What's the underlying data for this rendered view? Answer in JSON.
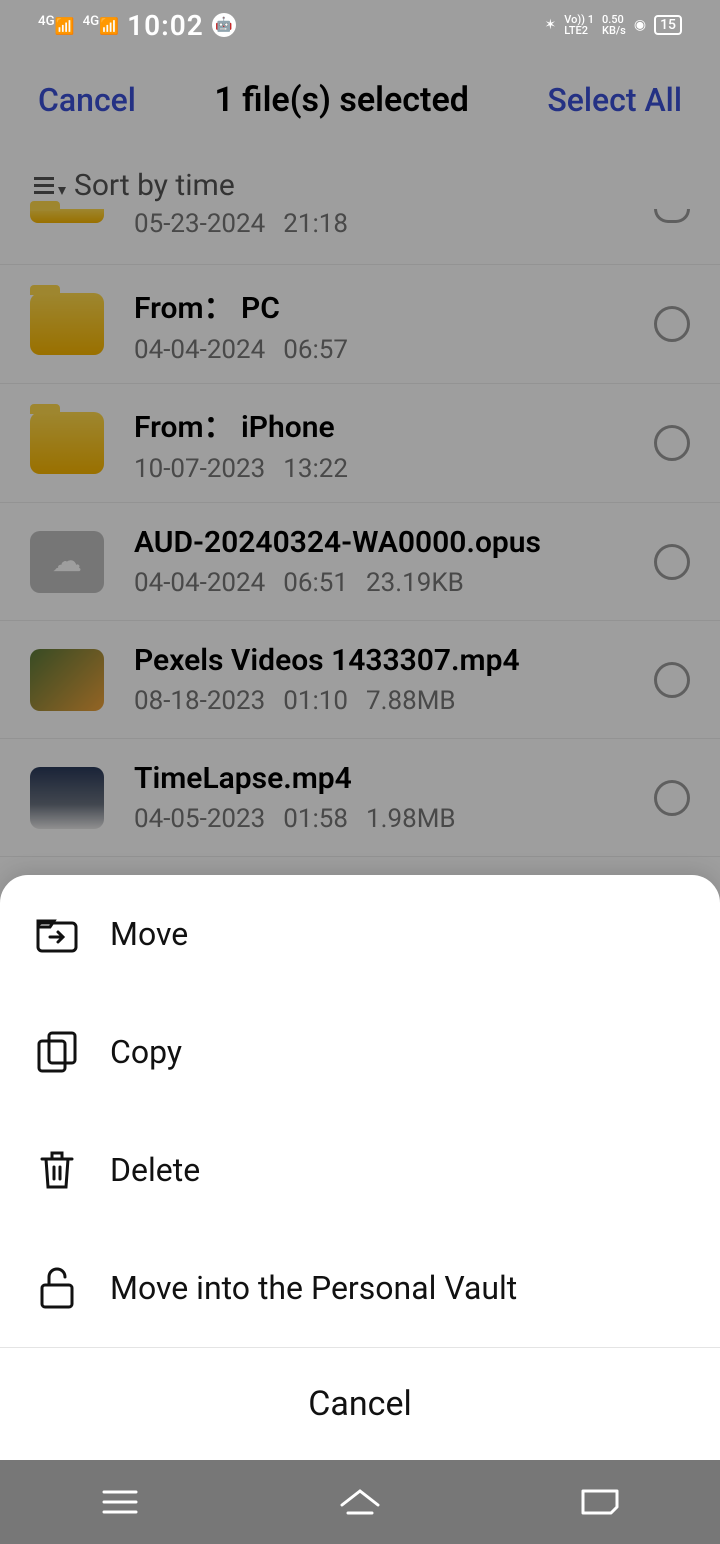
{
  "status": {
    "signal1": "4G",
    "signal2": "4G",
    "time": "10:02",
    "lte": "Vo)) 1\nLTE2",
    "speed": "0.50\nKB/s",
    "battery": "15"
  },
  "header": {
    "cancel": "Cancel",
    "title": "1 file(s) selected",
    "selectall": "Select All"
  },
  "sort": {
    "label": "Sort by time"
  },
  "rows": [
    {
      "name": "",
      "date": "05-23-2024",
      "time": "21:18",
      "size": "",
      "thumb": "folder",
      "partial": true
    },
    {
      "name": "From： PC",
      "date": "04-04-2024",
      "time": "06:57",
      "size": "",
      "thumb": "folder"
    },
    {
      "name": "From： iPhone",
      "date": "10-07-2023",
      "time": "13:22",
      "size": "",
      "thumb": "folder"
    },
    {
      "name": "AUD-20240324-WA0000.opus",
      "date": "04-04-2024",
      "time": "06:51",
      "size": "23.19KB",
      "thumb": "cloud"
    },
    {
      "name": "Pexels Videos 1433307.mp4",
      "date": "08-18-2023",
      "time": "01:10",
      "size": "7.88MB",
      "thumb": "img1"
    },
    {
      "name": "TimeLapse.mp4",
      "date": "04-05-2023",
      "time": "01:58",
      "size": "1.98MB",
      "thumb": "img2"
    }
  ],
  "actions": {
    "move": "Move",
    "copy": "Copy",
    "delete": "Delete",
    "vault": "Move into the Personal Vault",
    "cancel": "Cancel"
  }
}
